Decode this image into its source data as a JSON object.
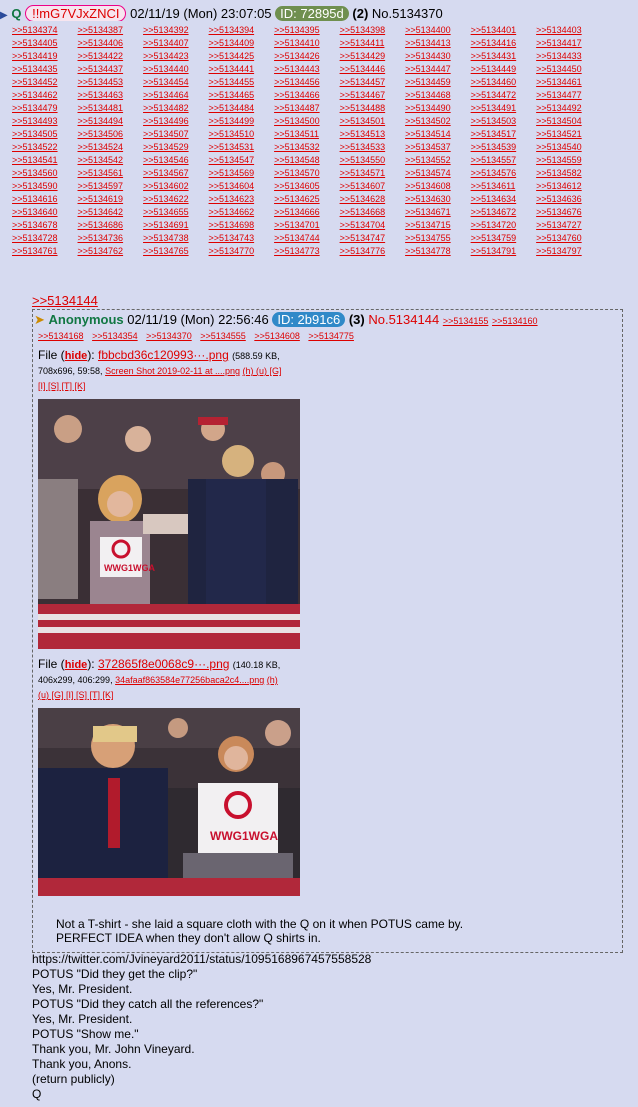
{
  "header": {
    "name": "Q",
    "tripcode": "!!mG7VJxZNCI",
    "datetime": "02/11/19 (Mon) 23:07:05",
    "id_label": "ID: 72895d",
    "reply_count": "(2)",
    "post_number": "No.5134370"
  },
  "reply_links": [
    ">>5134374",
    ">>5134387",
    ">>5134392",
    ">>5134394",
    ">>5134395",
    ">>5134398",
    ">>5134400",
    ">>5134401",
    ">>5134403",
    ">>5134405",
    ">>5134406",
    ">>5134407",
    ">>5134409",
    ">>5134410",
    ">>5134411",
    ">>5134413",
    ">>5134416",
    ">>5134417",
    ">>5134419",
    ">>5134422",
    ">>5134423",
    ">>5134425",
    ">>5134426",
    ">>5134429",
    ">>5134430",
    ">>5134431",
    ">>5134433",
    ">>5134435",
    ">>5134437",
    ">>5134440",
    ">>5134441",
    ">>5134443",
    ">>5134446",
    ">>5134447",
    ">>5134449",
    ">>5134450",
    ">>5134452",
    ">>5134453",
    ">>5134454",
    ">>5134455",
    ">>5134456",
    ">>5134457",
    ">>5134459",
    ">>5134460",
    ">>5134461",
    ">>5134462",
    ">>5134463",
    ">>5134464",
    ">>5134465",
    ">>5134466",
    ">>5134467",
    ">>5134468",
    ">>5134472",
    ">>5134477",
    ">>5134479",
    ">>5134481",
    ">>5134482",
    ">>5134484",
    ">>5134487",
    ">>5134488",
    ">>5134490",
    ">>5134491",
    ">>5134492",
    ">>5134493",
    ">>5134494",
    ">>5134496",
    ">>5134499",
    ">>5134500",
    ">>5134501",
    ">>5134502",
    ">>5134503",
    ">>5134504",
    ">>5134505",
    ">>5134506",
    ">>5134507",
    ">>5134510",
    ">>5134511",
    ">>5134513",
    ">>5134514",
    ">>5134517",
    ">>5134521",
    ">>5134522",
    ">>5134524",
    ">>5134529",
    ">>5134531",
    ">>5134532",
    ">>5134533",
    ">>5134537",
    ">>5134539",
    ">>5134540",
    ">>5134541",
    ">>5134542",
    ">>5134546",
    ">>5134547",
    ">>5134548",
    ">>5134550",
    ">>5134552",
    ">>5134557",
    ">>5134559",
    ">>5134560",
    ">>5134561",
    ">>5134567",
    ">>5134569",
    ">>5134570",
    ">>5134571",
    ">>5134574",
    ">>5134576",
    ">>5134582",
    ">>5134590",
    ">>5134597",
    ">>5134602",
    ">>5134604",
    ">>5134605",
    ">>5134607",
    ">>5134608",
    ">>5134611",
    ">>5134612",
    ">>5134616",
    ">>5134619",
    ">>5134622",
    ">>5134623",
    ">>5134625",
    ">>5134628",
    ">>5134630",
    ">>5134634",
    ">>5134636",
    ">>5134640",
    ">>5134642",
    ">>5134655",
    ">>5134662",
    ">>5134666",
    ">>5134668",
    ">>5134671",
    ">>5134672",
    ">>5134676",
    ">>5134678",
    ">>5134686",
    ">>5134691",
    ">>5134698",
    ">>5134701",
    ">>5134704",
    ">>5134715",
    ">>5134720",
    ">>5134727",
    ">>5134728",
    ">>5134736",
    ">>5134738",
    ">>5134743",
    ">>5134744",
    ">>5134747",
    ">>5134755",
    ">>5134759",
    ">>5134760",
    ">>5134761",
    ">>5134762",
    ">>5134765",
    ">>5134770",
    ">>5134773",
    ">>5134776",
    ">>5134778",
    ">>5134791",
    ">>5134797"
  ],
  "quoted_post": {
    "ref": ">>5134144",
    "name": "Anonymous",
    "datetime": "02/11/19 (Mon) 22:56:46",
    "id_label": "ID: 2b91c6",
    "reply_count": "(3)",
    "post_number": "No.5134144",
    "inline_links": [
      ">>5134155",
      ">>5134160"
    ],
    "backlinks": [
      ">>5134168",
      ">>5134354",
      ">>5134370",
      ">>5134555",
      ">>5134608",
      ">>5134775"
    ],
    "file1": {
      "label": "File",
      "hide": "hide",
      "name": "fbbcbd36c120993···.png",
      "size": "(588.59 KB,",
      "dims": "708x696, 59:58,",
      "orig": "Screen Shot 2019-02-11 at ....png",
      "tools": "(h) (u) [G]",
      "tools2": "[I] [S] [T] [K]"
    },
    "file2": {
      "label": "File",
      "hide": "hide",
      "name": "372865f8e0068c9···.png",
      "size": "(140.18 KB,",
      "dims": "406x299, 406:299,",
      "orig": "34afaaf863584e77256baca2c4....png",
      "tools": "(h)",
      "tools2": "(u) [G] [I] [S] [T] [K]"
    },
    "message": [
      "Not a T-shirt - she laid a square cloth with the Q on it when POTUS came by.",
      "PERFECT IDEA when they don't allow Q shirts in."
    ]
  },
  "body_lines": [
    "https://twitter.com/Jvineyard2011/status/1095168967457558528",
    "POTUS \"Did they get the clip?\"",
    "Yes, Mr. President.",
    "POTUS \"Did they catch all the references?\"",
    "Yes, Mr. President.",
    "POTUS \"Show me.\"",
    "Thank you, Mr. John Vineyard.",
    "Thank you, Anons.",
    "(return publicly)",
    "Q"
  ],
  "colors": {
    "background": "#d6daf0",
    "link": "#dd0000",
    "name": "#117743"
  }
}
